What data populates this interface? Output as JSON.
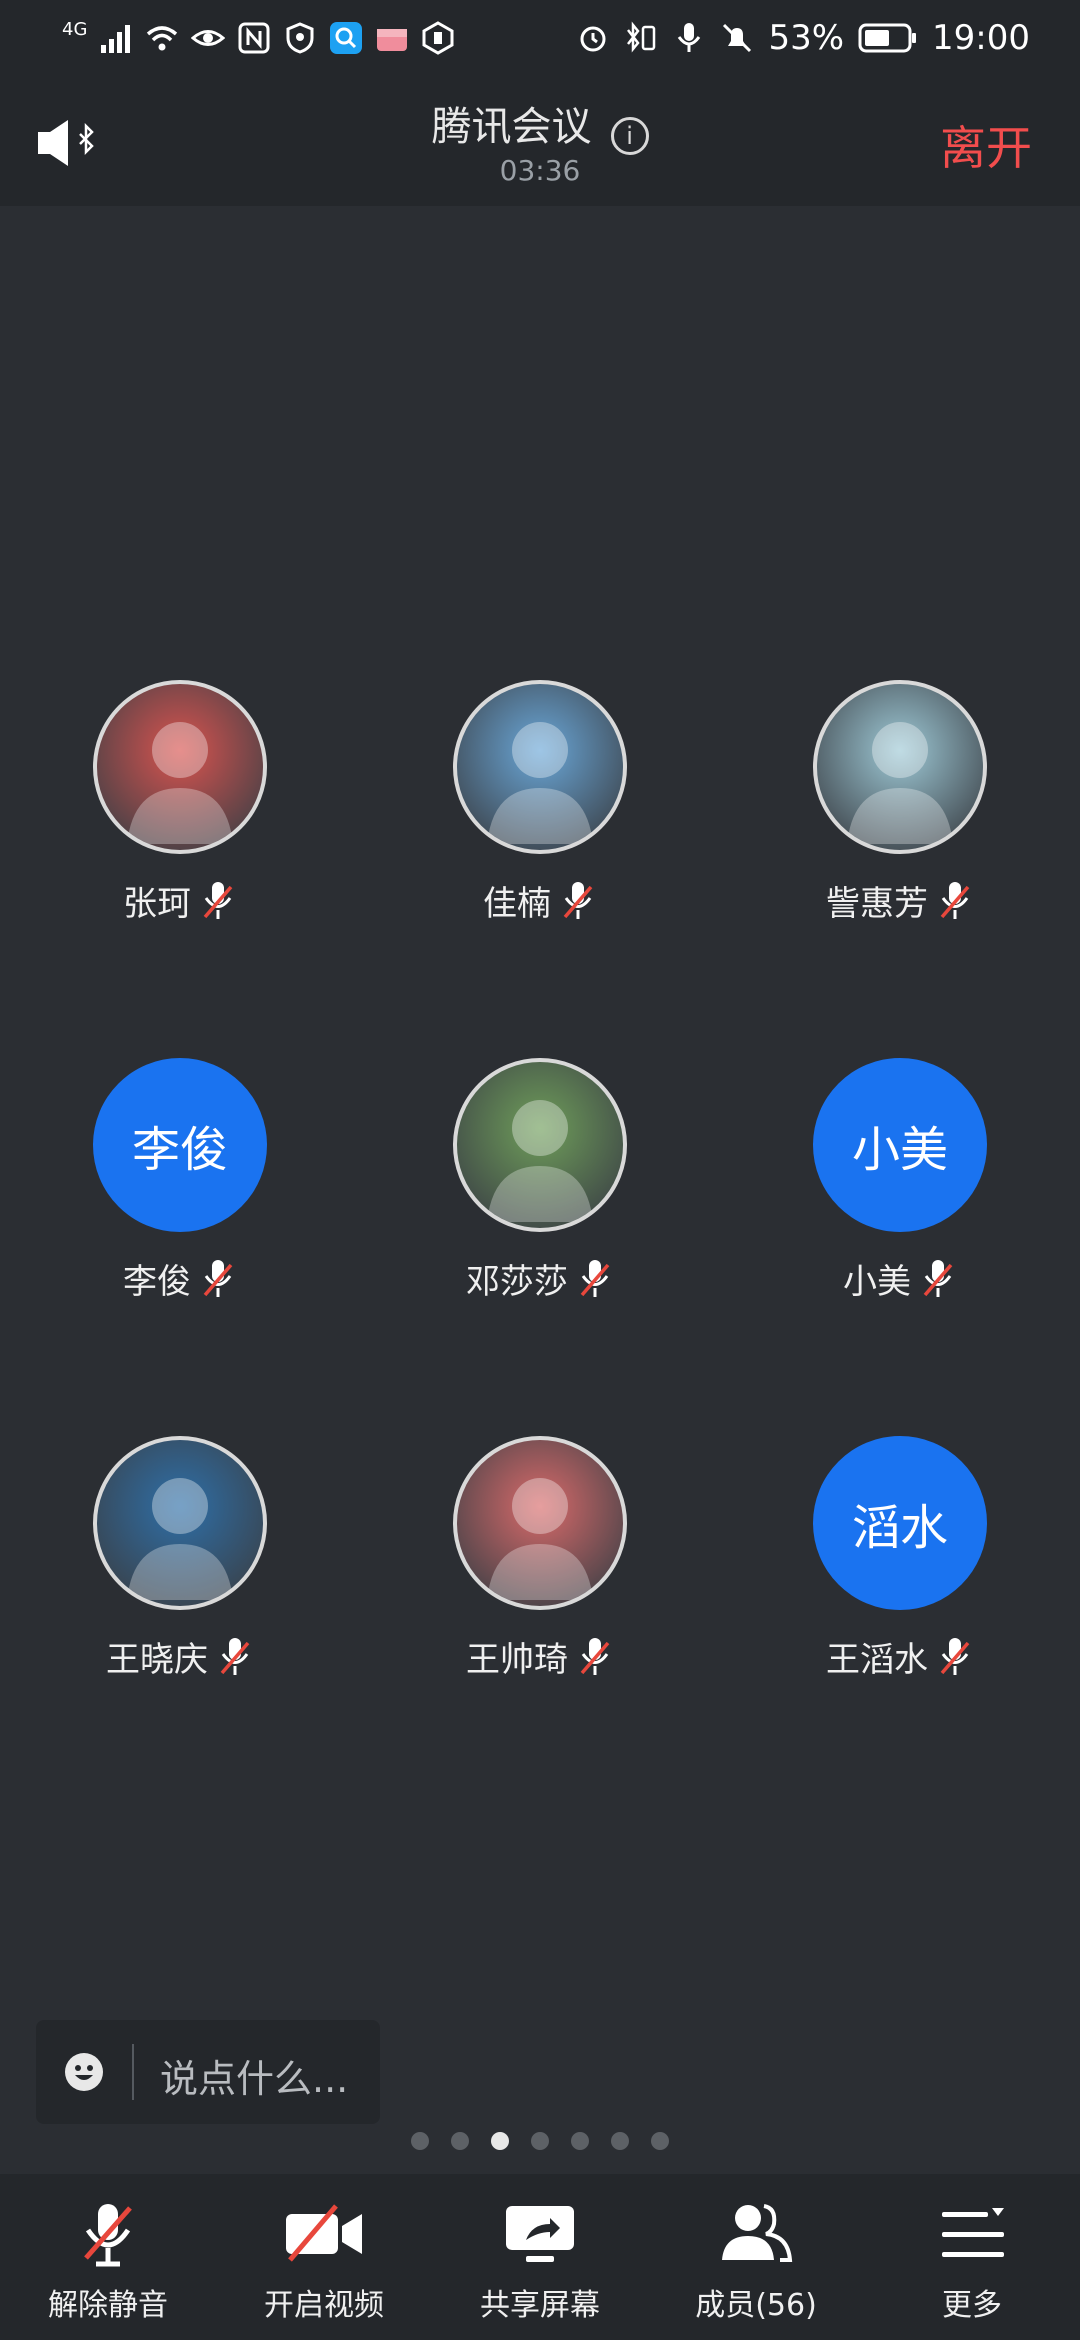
{
  "status_bar": {
    "network": "4G",
    "battery": "53%",
    "time": "19:00"
  },
  "header": {
    "title": "腾讯会议",
    "timer": "03:36",
    "leave_label": "离开"
  },
  "participants": [
    {
      "name": "张珂",
      "avatar_type": "photo",
      "avatar_text": "",
      "avatar_color": "#d9534f"
    },
    {
      "name": "佳楠",
      "avatar_type": "photo",
      "avatar_text": "",
      "avatar_color": "#6aa7d8"
    },
    {
      "name": "訾惠芳",
      "avatar_type": "photo",
      "avatar_text": "",
      "avatar_color": "#9ec9d6"
    },
    {
      "name": "李俊",
      "avatar_type": "initials",
      "avatar_text": "李俊",
      "avatar_color": "#1a73f0"
    },
    {
      "name": "邓莎莎",
      "avatar_type": "photo",
      "avatar_text": "",
      "avatar_color": "#6f9e5a"
    },
    {
      "name": "小美",
      "avatar_type": "initials",
      "avatar_text": "小美",
      "avatar_color": "#1a73f0"
    },
    {
      "name": "王晓庆",
      "avatar_type": "photo",
      "avatar_text": "",
      "avatar_color": "#2e6fa8"
    },
    {
      "name": "王帅琦",
      "avatar_type": "photo",
      "avatar_text": "",
      "avatar_color": "#d96a6a"
    },
    {
      "name": "王滔水",
      "avatar_type": "initials",
      "avatar_text": "滔水",
      "avatar_color": "#1a73f0"
    }
  ],
  "chat": {
    "placeholder": "说点什么..."
  },
  "pager": {
    "total": 7,
    "active_index": 2
  },
  "toolbar": {
    "unmute": "解除静音",
    "start_video": "开启视频",
    "share_screen": "共享屏幕",
    "members": "成员(56)",
    "more": "更多"
  },
  "colors": {
    "background": "#2b2e33",
    "bar": "#24272b",
    "leave_red": "#f24d4d",
    "avatar_blue": "#1a73f0",
    "muted_red": "#e8473c"
  }
}
